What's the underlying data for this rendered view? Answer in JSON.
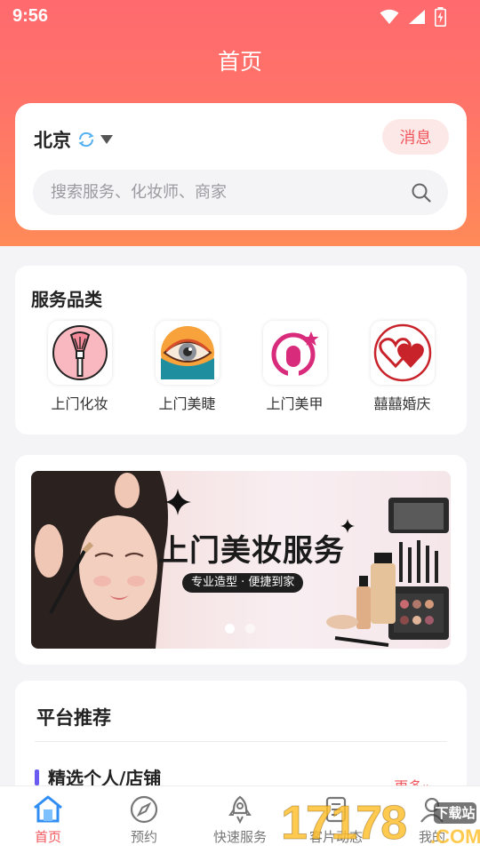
{
  "status_bar": {
    "time": "9:56"
  },
  "header": {
    "title": "首页"
  },
  "location": {
    "city": "北京"
  },
  "message_button": {
    "label": "消息"
  },
  "search": {
    "placeholder": "搜索服务、化妆师、商家"
  },
  "services": {
    "title": "服务品类",
    "items": [
      {
        "label": "上门化妆",
        "icon": "makeup-brush-icon"
      },
      {
        "label": "上门美睫",
        "icon": "eye-lash-icon"
      },
      {
        "label": "上门美甲",
        "icon": "nail-icon"
      },
      {
        "label": "囍囍婚庆",
        "icon": "double-heart-icon"
      }
    ]
  },
  "banner": {
    "title": "上门美妆服务",
    "subtitle": "专业造型 · 便捷到家",
    "slides": 2,
    "active_slide": 1
  },
  "recommend": {
    "title": "平台推荐",
    "section_title": "精选个人/店铺",
    "more_label": "更多»"
  },
  "bottom_nav": {
    "items": [
      {
        "label": "首页",
        "icon": "home-icon",
        "active": true
      },
      {
        "label": "预约",
        "icon": "compass-icon",
        "active": false
      },
      {
        "label": "快速服务",
        "icon": "rocket-icon",
        "active": false
      },
      {
        "label": "客片动态",
        "icon": "gallery-icon",
        "active": false
      },
      {
        "label": "我的",
        "icon": "user-icon",
        "active": false
      }
    ]
  },
  "watermark": {
    "number": "17178",
    "label": "下载站",
    "domain": ".COM"
  },
  "colors": {
    "accent": "#f0575d",
    "header_top": "#ff6a6e",
    "header_bottom": "#ff8a58"
  }
}
